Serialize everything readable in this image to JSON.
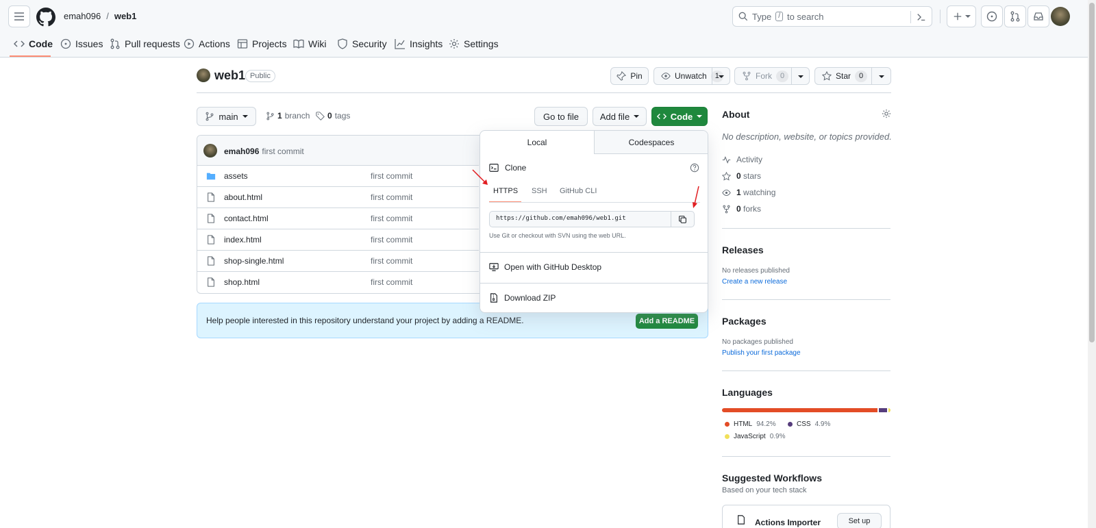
{
  "header": {
    "owner": "emah096",
    "separator": "/",
    "repo": "web1",
    "search_prefix": "Type",
    "search_key": "/",
    "search_suffix": "to search"
  },
  "nav": [
    {
      "label": "Code",
      "icon": "code-icon",
      "active": true
    },
    {
      "label": "Issues",
      "icon": "issue-icon"
    },
    {
      "label": "Pull requests",
      "icon": "pull-request-icon"
    },
    {
      "label": "Actions",
      "icon": "play-icon"
    },
    {
      "label": "Projects",
      "icon": "table-icon"
    },
    {
      "label": "Wiki",
      "icon": "book-icon"
    },
    {
      "label": "Security",
      "icon": "shield-icon"
    },
    {
      "label": "Insights",
      "icon": "graph-icon"
    },
    {
      "label": "Settings",
      "icon": "gear-icon"
    }
  ],
  "repo_head": {
    "name": "web1",
    "visibility": "Public",
    "pin": "Pin",
    "unwatch": "Unwatch",
    "watch_count": "1",
    "fork": "Fork",
    "fork_count": "0",
    "star": "Star",
    "star_count": "0"
  },
  "toolbar": {
    "branch": "main",
    "branch_count": "1",
    "branch_label": "branch",
    "tag_count": "0",
    "tag_label": "tags",
    "go_to_file": "Go to file",
    "add_file": "Add file",
    "code": "Code"
  },
  "commit": {
    "author": "emah096",
    "message": "first commit"
  },
  "files": [
    {
      "name": "assets",
      "type": "folder",
      "message": "first commit"
    },
    {
      "name": "about.html",
      "type": "file",
      "message": "first commit"
    },
    {
      "name": "contact.html",
      "type": "file",
      "message": "first commit"
    },
    {
      "name": "index.html",
      "type": "file",
      "message": "first commit"
    },
    {
      "name": "shop-single.html",
      "type": "file",
      "message": "first commit"
    },
    {
      "name": "shop.html",
      "type": "file",
      "message": "first commit"
    }
  ],
  "readme_banner": {
    "text": "Help people interested in this repository understand your project by adding a README.",
    "button": "Add a README"
  },
  "clone_popup": {
    "tabs": [
      "Local",
      "Codespaces"
    ],
    "active_tab": "Local",
    "clone_title": "Clone",
    "protocols": [
      "HTTPS",
      "SSH",
      "GitHub CLI"
    ],
    "active_protocol": "HTTPS",
    "url": "https://github.com/emah096/web1.git",
    "hint": "Use Git or checkout with SVN using the web URL.",
    "desktop": "Open with GitHub Desktop",
    "zip": "Download ZIP"
  },
  "about": {
    "title": "About",
    "description": "No description, website, or topics provided.",
    "activity": "Activity",
    "stars_count": "0",
    "stars_label": "stars",
    "watching_count": "1",
    "watching_label": "watching",
    "forks_count": "0",
    "forks_label": "forks"
  },
  "releases": {
    "title": "Releases",
    "none": "No releases published",
    "link": "Create a new release"
  },
  "packages": {
    "title": "Packages",
    "none": "No packages published",
    "link": "Publish your first package"
  },
  "languages": {
    "title": "Languages",
    "items": [
      {
        "name": "HTML",
        "percent": "94.2%",
        "value": 94.2,
        "color": "#e34c26"
      },
      {
        "name": "CSS",
        "percent": "4.9%",
        "value": 4.9,
        "color": "#563d7c"
      },
      {
        "name": "JavaScript",
        "percent": "0.9%",
        "value": 0.9,
        "color": "#f1e05a"
      }
    ]
  },
  "workflows": {
    "title": "Suggested Workflows",
    "subtitle": "Based on your tech stack",
    "item": "Actions Importer",
    "button": "Set up"
  },
  "colors": {
    "accent_green": "#1f883d",
    "link_blue": "#0969da",
    "active_underline": "#fd8c73",
    "annotation_red": "#e11d21"
  }
}
